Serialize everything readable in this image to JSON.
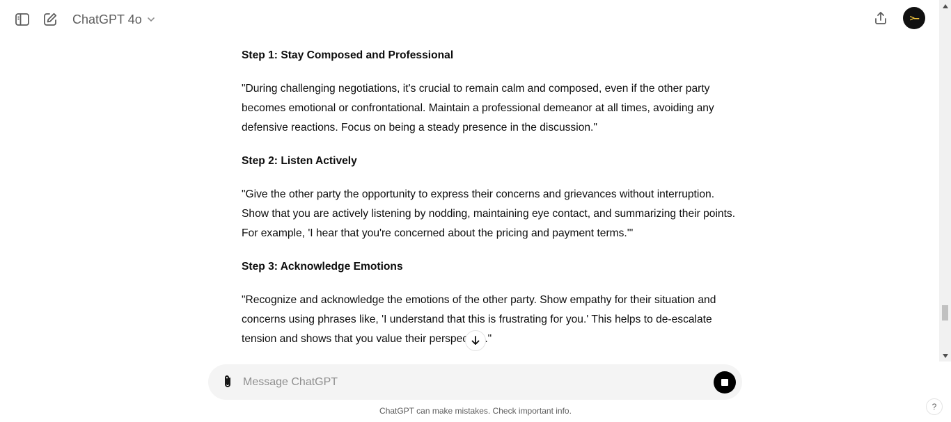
{
  "header": {
    "model_name": "ChatGPT 4o",
    "icons": [
      "sidebar-toggle-icon",
      "new-chat-icon",
      "chevron-down-icon",
      "share-icon"
    ],
    "avatar_text": ">–"
  },
  "conversation": {
    "blocks": [
      {
        "heading": "Step 1: Stay Composed and Professional",
        "body": "\"During challenging negotiations, it's crucial to remain calm and composed, even if the other party becomes emotional or confrontational. Maintain a professional demeanor at all times, avoiding any defensive reactions. Focus on being a steady presence in the discussion.\""
      },
      {
        "heading": "Step 2: Listen Actively",
        "body": "\"Give the other party the opportunity to express their concerns and grievances without interruption. Show that you are actively listening by nodding, maintaining eye contact, and summarizing their points. For example, 'I hear that you're concerned about the pricing and payment terms.'\""
      },
      {
        "heading": "Step 3: Acknowledge Emotions",
        "body": "\"Recognize and acknowledge the emotions of the other party. Show empathy for their situation and concerns using phrases like, 'I understand that this is frustrating for you.' This helps to de-escalate tension and shows that you value their perspective.\""
      }
    ]
  },
  "composer": {
    "placeholder": "Message ChatGPT",
    "value": ""
  },
  "footer": {
    "disclaimer": "ChatGPT can make mistakes. Check important info.",
    "help_label": "?"
  },
  "colors": {
    "text": "#0d0d0d",
    "muted": "#5d5d5d",
    "composer_bg": "#f4f4f4",
    "avatar_bg": "#111111",
    "avatar_fg": "#f0c43c"
  }
}
